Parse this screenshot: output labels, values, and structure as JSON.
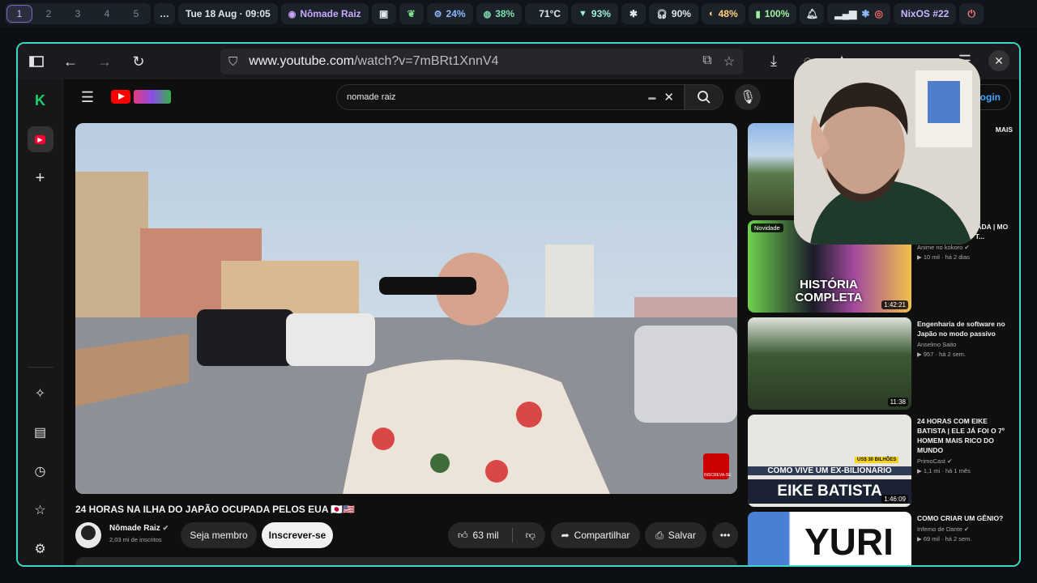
{
  "topbar": {
    "workspaces": [
      "1",
      "2",
      "3",
      "4",
      "5"
    ],
    "overflow": "…",
    "datetime": "Tue 18 Aug · 09:05",
    "active_window": "Nômade Raiz",
    "cpu": "24%",
    "mem": "38%",
    "temp": "71°C",
    "wifi": "93%",
    "headset": "90%",
    "brightness": "48%",
    "battery": "100%",
    "distro": "NixOS #22"
  },
  "browser": {
    "url_host": "www.youtube.com",
    "url_path": "/watch?v=7mBRt1XnnV4"
  },
  "youtube": {
    "search_value": "nomade raiz",
    "login_label": "login",
    "video": {
      "title": "24 HORAS NA ILHA DO JAPÃO OCUPADA PELOS EUA 🇯🇵🇺🇸",
      "channel": "Nômade Raiz",
      "subs": "2,03 mi de inscritos",
      "member_label": "Seja membro",
      "subscribe_label": "Inscrever-se",
      "likes": "63 mil",
      "share_label": "Compartilhar",
      "save_label": "Salvar",
      "overlay_label": "INSCREVA-SE"
    },
    "recs": [
      {
        "title": "MAIS",
        "channel": "",
        "views": "",
        "age": "",
        "duration": "",
        "badge": ""
      },
      {
        "title": "HISTÓRIA EXPLICADA | MO DE LELOUCH OF T...",
        "channel": "Anime no kokoro",
        "views": "10 mil",
        "age": "há 2 dias",
        "duration": "1:42:21",
        "badge": "Novidade",
        "thumb_text": "HISTÓRIA COMPLETA"
      },
      {
        "title": "Engenharia de software no Japão no modo passivo",
        "channel": "Anselmo Saito",
        "views": "957",
        "age": "há 2 sem.",
        "duration": "11:38",
        "badge": ""
      },
      {
        "title": "24 HORAS COM EIKE BATISTA | ELE JÁ FOI O 7º HOMEM MAIS RICO DO MUNDO",
        "channel": "PrimoCast",
        "views": "1,1 mi",
        "age": "há 1 mês",
        "duration": "1:46:09",
        "badge": "",
        "thumb_text_1": "COMO VIVE UM EX-BILIONÁRIO",
        "thumb_text_2": "EIKE BATISTA",
        "thumb_tag": "US$ 30 BILHÕES"
      },
      {
        "title": "COMO CRIAR UM GÊNIO?",
        "channel": "Inferno de Dante",
        "views": "69 mil",
        "age": "há 2 sem.",
        "duration": "",
        "badge": "",
        "thumb_text": "YURI"
      }
    ]
  },
  "colors": {
    "window_border": "#3fd6c7",
    "yt_red": "#ff0000",
    "link_blue": "#3ea6ff"
  }
}
